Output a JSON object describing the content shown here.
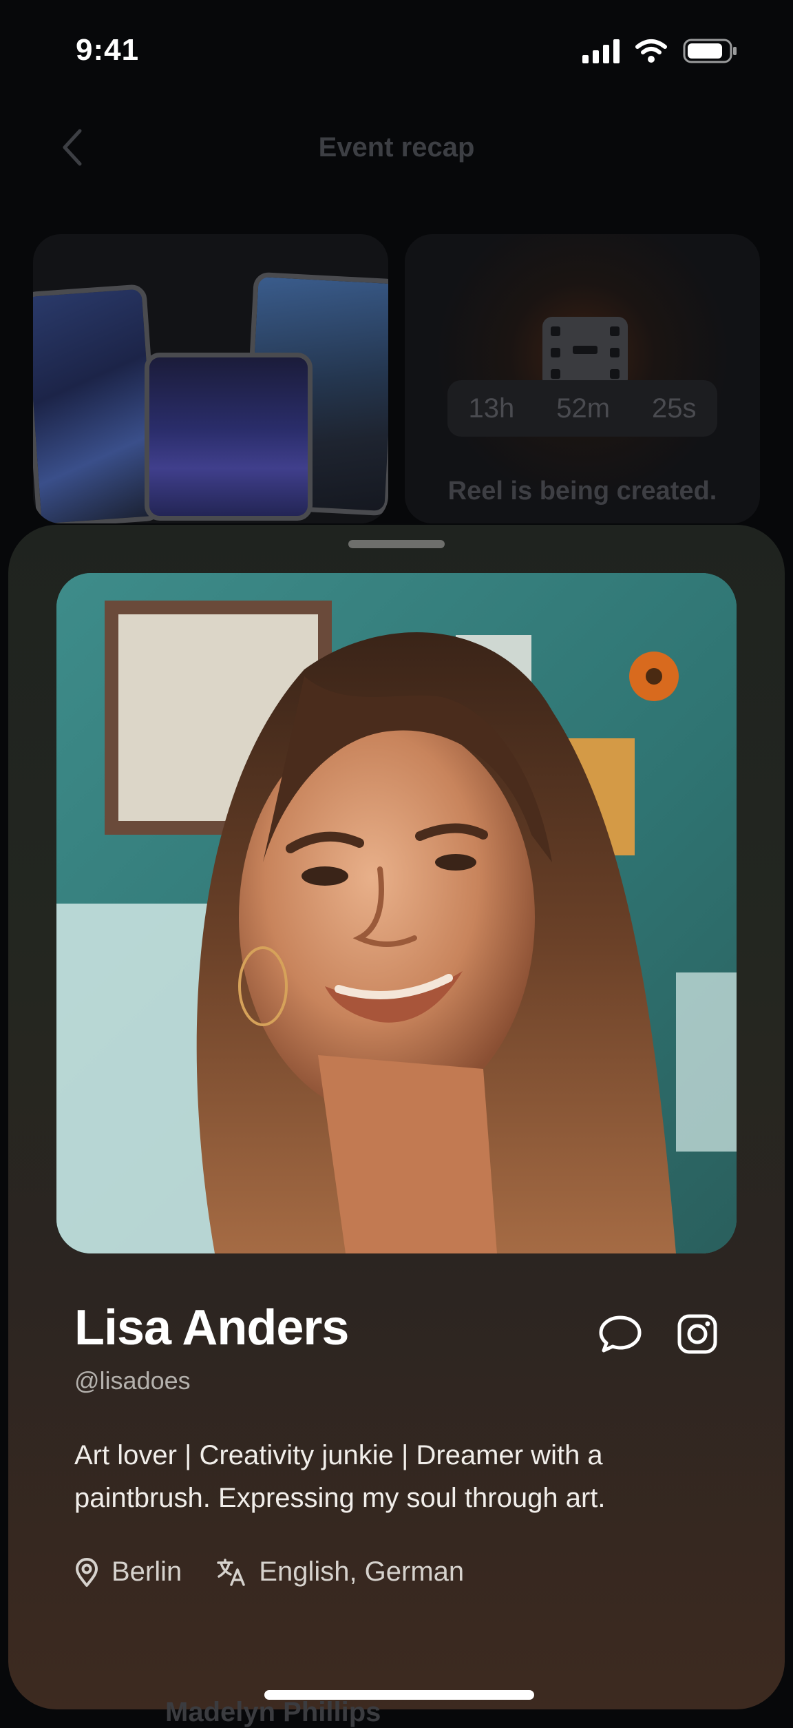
{
  "status_bar": {
    "time": "9:41"
  },
  "nav": {
    "title": "Event recap"
  },
  "reel": {
    "timer_hours": "13h",
    "timer_minutes": "52m",
    "timer_seconds": "25s",
    "status_text": "Reel is being created."
  },
  "profile": {
    "name": "Lisa Anders",
    "handle": "@lisadoes",
    "bio": "Art lover | Creativity junkie | Dreamer with a paintbrush. Expressing my soul through art.",
    "location": "Berlin",
    "languages": "English, German"
  },
  "peek_text": "Madelyn Phillips",
  "colors": {
    "background": "#07080a",
    "sheet_top": "#1f231f",
    "sheet_bottom": "#3d2a20"
  },
  "icons": [
    "chevron-left-icon",
    "signal-icon",
    "wifi-icon",
    "battery-icon",
    "film-icon",
    "chat-bubble-icon",
    "instagram-icon",
    "location-pin-icon",
    "translate-icon"
  ]
}
